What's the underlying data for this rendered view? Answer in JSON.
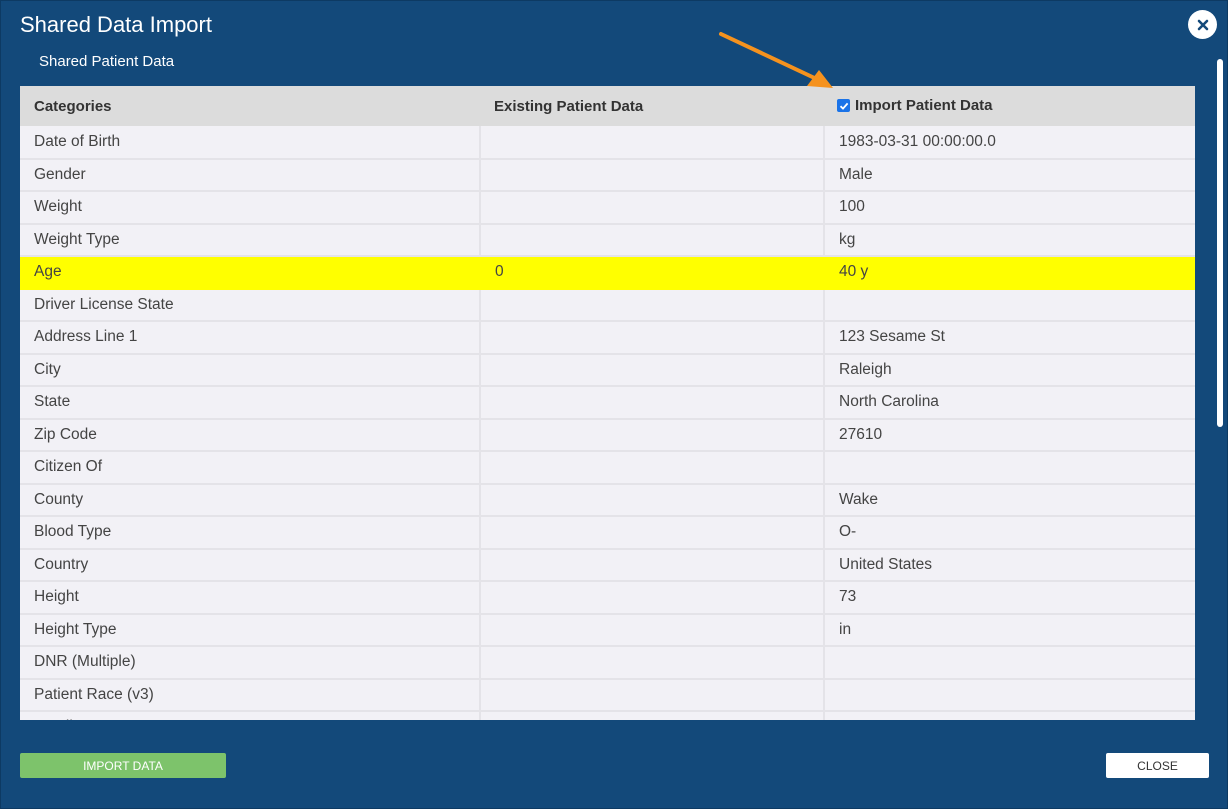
{
  "dialog": {
    "title": "Shared Data Import",
    "subtitle": "Shared Patient Data"
  },
  "table": {
    "headers": {
      "categories": "Categories",
      "existing": "Existing Patient Data",
      "import": "Import Patient Data"
    },
    "import_checked": true,
    "rows": [
      {
        "category": "Date of Birth",
        "existing": "",
        "import": "1983-03-31 00:00:00.0"
      },
      {
        "category": "Gender",
        "existing": "",
        "import": "Male"
      },
      {
        "category": "Weight",
        "existing": "",
        "import": "100"
      },
      {
        "category": "Weight Type",
        "existing": "",
        "import": "kg"
      },
      {
        "category": "Age",
        "existing": "0",
        "import": "40 y",
        "highlight": true
      },
      {
        "category": "Driver License State",
        "existing": "",
        "import": ""
      },
      {
        "category": "Address Line 1",
        "existing": "",
        "import": "123 Sesame St"
      },
      {
        "category": "City",
        "existing": "",
        "import": "Raleigh"
      },
      {
        "category": "State",
        "existing": "",
        "import": "North Carolina"
      },
      {
        "category": "Zip Code",
        "existing": "",
        "import": "27610"
      },
      {
        "category": "Citizen Of",
        "existing": "",
        "import": ""
      },
      {
        "category": "County",
        "existing": "",
        "import": "Wake"
      },
      {
        "category": "Blood Type",
        "existing": "",
        "import": "O-"
      },
      {
        "category": "Country",
        "existing": "",
        "import": "United States"
      },
      {
        "category": "Height",
        "existing": "",
        "import": "73"
      },
      {
        "category": "Height Type",
        "existing": "",
        "import": "in"
      },
      {
        "category": "DNR (Multiple)",
        "existing": "",
        "import": ""
      },
      {
        "category": "Patient Race (v3)",
        "existing": "",
        "import": ""
      },
      {
        "category": "Email",
        "existing": "",
        "import": ""
      }
    ]
  },
  "footer": {
    "import_label": "IMPORT DATA",
    "close_label": "CLOSE"
  },
  "colors": {
    "dialog_bg": "#13497a",
    "highlight": "#ffff00",
    "import_button": "#7dc36b",
    "checkbox": "#1a73e8",
    "annotation_arrow": "#f5921e"
  },
  "icons": {
    "close": "close-x-icon",
    "checkbox": "checkmark-icon"
  }
}
